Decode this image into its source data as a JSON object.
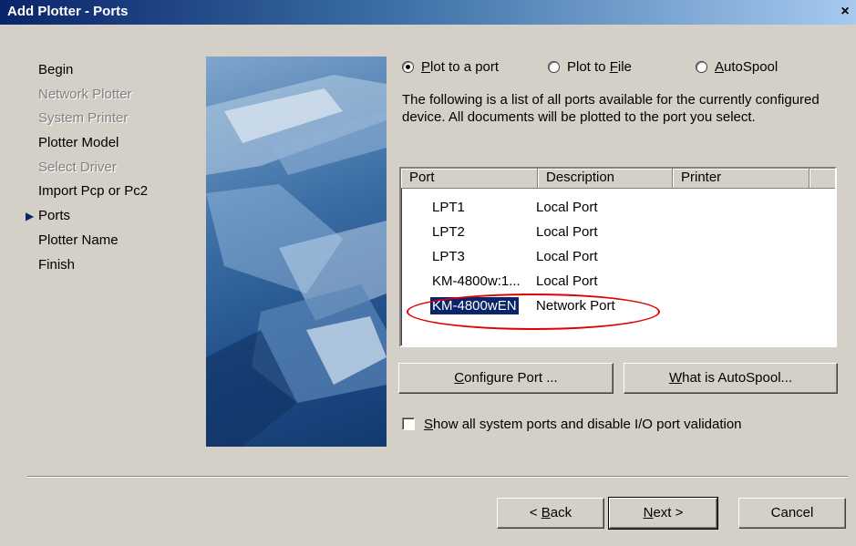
{
  "window": {
    "title": "Add Plotter - Ports",
    "close_glyph": "×"
  },
  "steps": [
    {
      "label": "Begin",
      "state": "enabled"
    },
    {
      "label": "Network Plotter",
      "state": "disabled"
    },
    {
      "label": "System Printer",
      "state": "disabled"
    },
    {
      "label": "Plotter Model",
      "state": "enabled"
    },
    {
      "label": "Select Driver",
      "state": "disabled"
    },
    {
      "label": "Import Pcp or Pc2",
      "state": "enabled"
    },
    {
      "label": "Ports",
      "state": "current"
    },
    {
      "label": "Plotter Name",
      "state": "enabled"
    },
    {
      "label": "Finish",
      "state": "enabled"
    }
  ],
  "radios": {
    "plot_to_port": {
      "label_pre": "",
      "label_key": "P",
      "label_post": "lot to a port",
      "checked": true
    },
    "plot_to_file": {
      "label_pre": "Plot to ",
      "label_key": "F",
      "label_post": "ile",
      "checked": false
    },
    "autospool": {
      "label_pre": "",
      "label_key": "A",
      "label_post": "utoSpool",
      "checked": false
    }
  },
  "description": "The following is a list of all ports available for the currently configured device. All documents will be plotted to the port you select.",
  "ports_table": {
    "columns": [
      "Port",
      "Description",
      "Printer"
    ],
    "rows": [
      {
        "port": "LPT1",
        "description": "Local Port",
        "printer": ""
      },
      {
        "port": "LPT2",
        "description": "Local Port",
        "printer": ""
      },
      {
        "port": "LPT3",
        "description": "Local Port",
        "printer": ""
      },
      {
        "port": "KM-4800w:1...",
        "description": "Local Port",
        "printer": ""
      },
      {
        "port": "KM-4800wEN",
        "description": "Network Port",
        "printer": "",
        "selected": true
      }
    ]
  },
  "buttons": {
    "configure_port": {
      "pre": "",
      "key": "C",
      "post": "onfigure Port ..."
    },
    "what_is_autospool": {
      "pre": "",
      "key": "W",
      "post": "hat is AutoSpool..."
    },
    "back": {
      "pre": "< ",
      "key": "B",
      "post": "ack"
    },
    "next": {
      "pre": "",
      "key": "N",
      "post": "ext >"
    },
    "cancel": {
      "label": "Cancel"
    }
  },
  "checkbox": {
    "pre": "",
    "key": "S",
    "post": "how all system ports and disable I/O port validation",
    "checked": false
  },
  "colors": {
    "dialog_bg": "#d4d0c8",
    "title_gradient_start": "#0a246a",
    "selection": "#0a246a",
    "annotation_ellipse": "#e00000"
  }
}
